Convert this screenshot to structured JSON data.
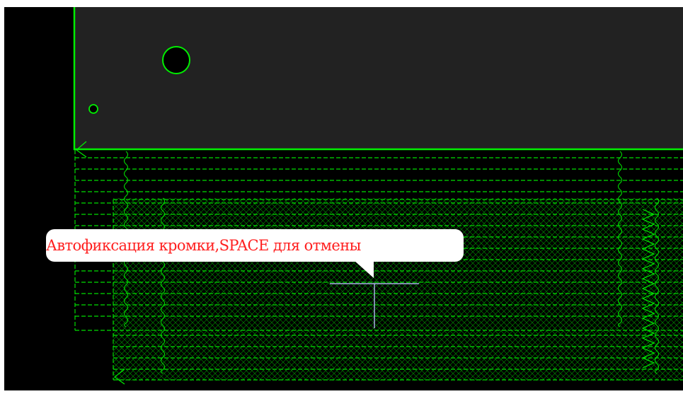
{
  "tooltip": {
    "text": "Автофиксация кромки,SPACE для отмены"
  },
  "colors": {
    "background": "#000000",
    "panel_fill": "#222222",
    "outline": "#00ee00",
    "hatch": "#00dd00",
    "crosshair": "#a9b0e6",
    "tooltip_text": "#ff2020",
    "tooltip_bg": "#ffffff"
  },
  "icons": {
    "cursor": "crosshair-cursor-icon",
    "edge_marker": "arrow-edge-marker-icon"
  }
}
